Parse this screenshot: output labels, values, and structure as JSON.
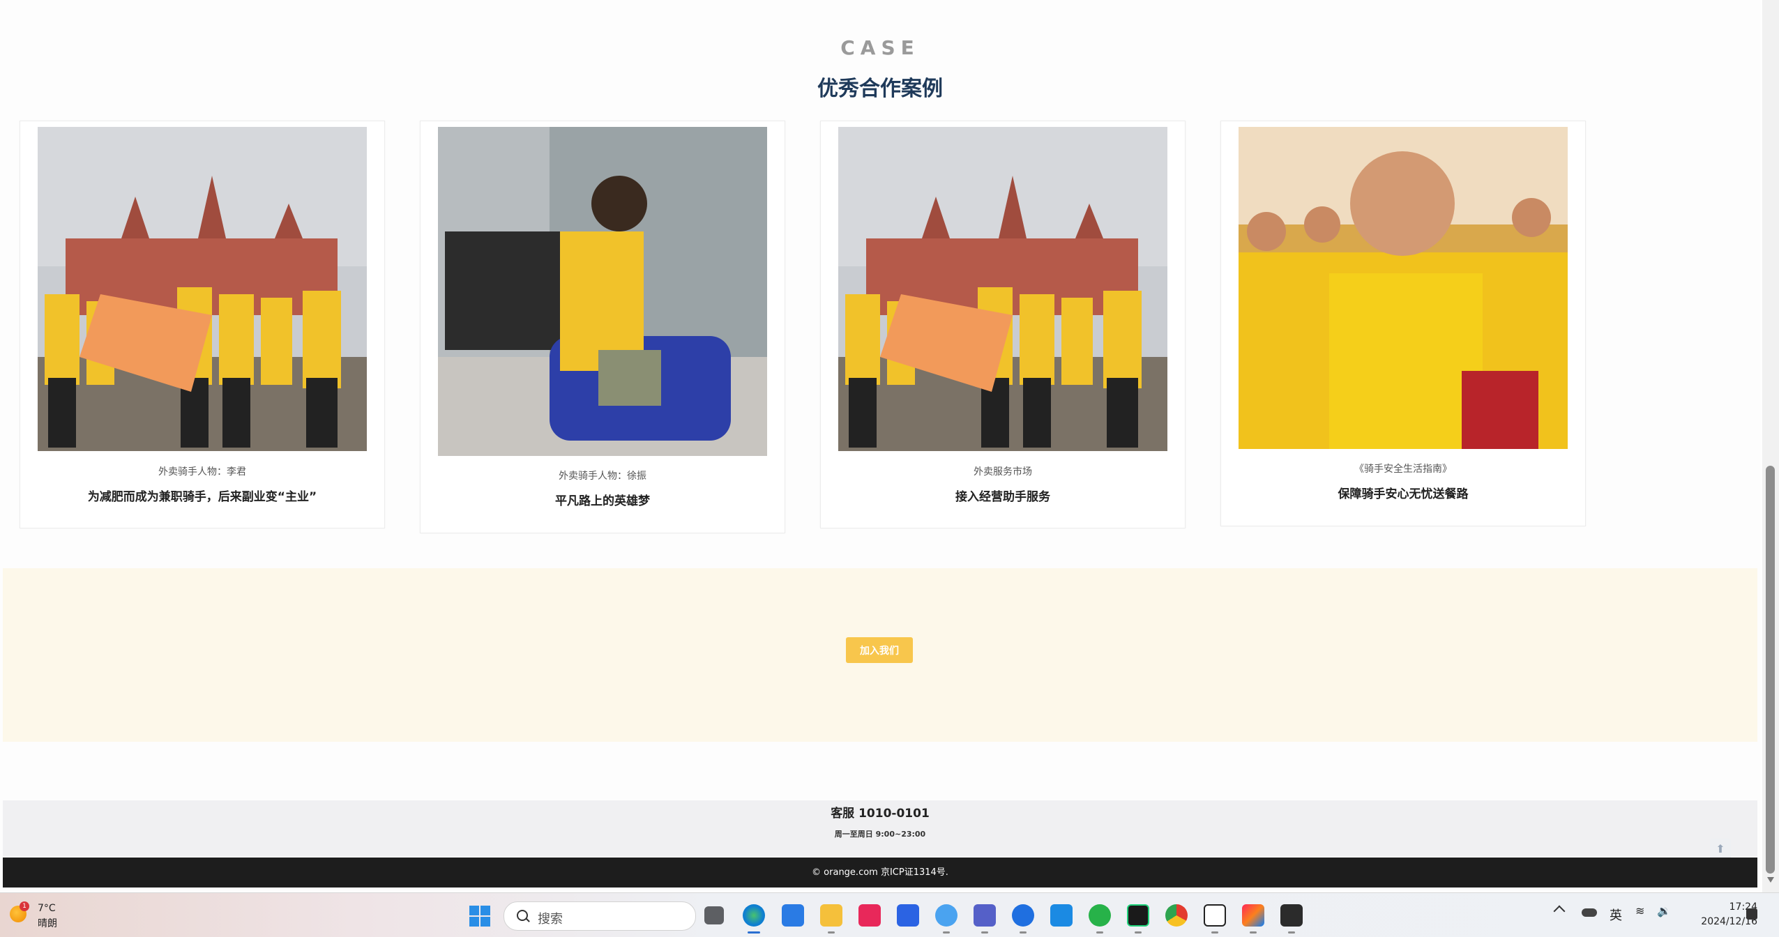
{
  "section": {
    "eyebrow": "CASE",
    "heading": "优秀合作案例"
  },
  "cases": [
    {
      "subtitle": "外卖骑手人物：李君",
      "title": "为减肥而成为兼职骑手，后来副业变“主业”"
    },
    {
      "subtitle": "外卖骑手人物：徐振",
      "title": "平凡路上的英雄梦"
    },
    {
      "subtitle": "外卖服务市场",
      "title": "接入经营助手服务"
    },
    {
      "subtitle": "《骑手安全生活指南》",
      "title": "保障骑手安心无忧送餐路"
    }
  ],
  "join": {
    "button_label": "加入我们"
  },
  "service": {
    "phone": "客服 1010-0101",
    "hours": "周一至周日 9:00~23:00"
  },
  "footer": {
    "text": "© orange.com 京ICP证1314号."
  },
  "taskbar": {
    "weather": {
      "temp": "7°C",
      "condition": "晴朗",
      "badge": "1"
    },
    "search_placeholder": "搜索",
    "ime": "英",
    "time": "17:24",
    "date": "2024/12/16",
    "apps": [
      "start-icon",
      "task-view-icon",
      "edge-icon",
      "store-icon",
      "file-explorer-icon",
      "app-icon",
      "feishu-icon",
      "baidu-netdisk-icon",
      "teams-icon",
      "edge-dev-icon",
      "whiteboard-icon",
      "wechat-icon",
      "pycharm-icon",
      "chrome-icon",
      "typora-icon",
      "intellij-icon",
      "terminal-icon"
    ]
  }
}
